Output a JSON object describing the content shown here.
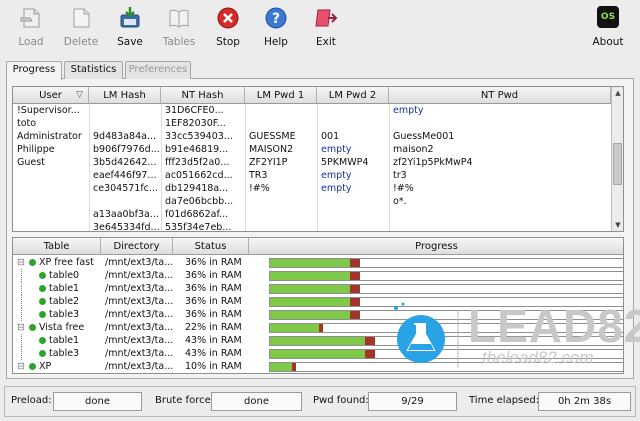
{
  "toolbar": {
    "load": "Load",
    "delete": "Delete",
    "save": "Save",
    "tables": "Tables",
    "stop": "Stop",
    "help": "Help",
    "exit": "Exit",
    "about": "About",
    "about_badge": "OS"
  },
  "tabs": [
    "Progress",
    "Statistics",
    "Preferences"
  ],
  "upper_table": {
    "columns": [
      "User",
      "LM Hash",
      "NT Hash",
      "LM Pwd 1",
      "LM Pwd 2",
      "NT Pwd"
    ],
    "rows": [
      [
        "!Supervisor...",
        "",
        "31D6CFE0...",
        "",
        "",
        "empty"
      ],
      [
        "toto",
        "",
        "1EF82030F...",
        "",
        "",
        ""
      ],
      [
        "Administrator",
        "9d483a84a...",
        "33cc539403...",
        "GUESSME",
        "001",
        "GuessMe001"
      ],
      [
        "Philippe",
        "b906f7976d...",
        "b91e46819...",
        "MAISON2",
        "empty",
        "maison2"
      ],
      [
        "Guest",
        "3b5d42642...",
        "fff23d5f2a0...",
        "ZF2YI1P",
        "5PKMWP4",
        "zf2Yi1p5PkMwP4"
      ],
      [
        "",
        "eaef446f97...",
        "ac051662cd...",
        "TR3",
        "empty",
        "tr3"
      ],
      [
        "",
        "ce304571fc...",
        "db129418a...",
        "!#%",
        "empty",
        "!#%"
      ],
      [
        "",
        "",
        "da7e06bcbb...",
        "",
        "",
        "o*."
      ],
      [
        "",
        "a13aa0bf3a...",
        "f01d6862af...",
        "",
        "",
        ""
      ],
      [
        "",
        "3e645334fd...",
        "535f34e7eb...",
        "",
        "",
        ""
      ]
    ],
    "blue_values": [
      "empty"
    ]
  },
  "lower_table": {
    "columns": [
      "Table",
      "Directory",
      "Status",
      "Progress"
    ],
    "rows": [
      {
        "indent": 0,
        "name": "XP free fast",
        "dir": "/mnt/ext3/ta...",
        "status": "36% in RAM",
        "progress": 0.36
      },
      {
        "indent": 1,
        "name": "table0",
        "dir": "/mnt/ext3/ta...",
        "status": "36% in RAM",
        "progress": 0.36
      },
      {
        "indent": 1,
        "name": "table1",
        "dir": "/mnt/ext3/ta...",
        "status": "36% in RAM",
        "progress": 0.36
      },
      {
        "indent": 1,
        "name": "table2",
        "dir": "/mnt/ext3/ta...",
        "status": "36% in RAM",
        "progress": 0.36
      },
      {
        "indent": 1,
        "name": "table3",
        "dir": "/mnt/ext3/ta...",
        "status": "36% in RAM",
        "progress": 0.36
      },
      {
        "indent": 0,
        "name": "Vista free",
        "dir": "/mnt/ext3/ta...",
        "status": "22% in RAM",
        "progress": 0.22
      },
      {
        "indent": 1,
        "name": "table1",
        "dir": "/mnt/ext3/ta...",
        "status": "43% in RAM",
        "progress": 0.43
      },
      {
        "indent": 1,
        "name": "table3",
        "dir": "/mnt/ext3/ta...",
        "status": "43% in RAM",
        "progress": 0.43
      },
      {
        "indent": 0,
        "name": "XP",
        "dir": "/mnt/ext3/ta...",
        "status": "10% in RAM",
        "progress": 0.1
      }
    ]
  },
  "status_bar": {
    "preload_label": "Preload:",
    "preload_value": "done",
    "brute_label": "Brute force:",
    "brute_value": "done",
    "pwd_label": "Pwd found:",
    "pwd_value": "9/29",
    "time_label": "Time elapsed:",
    "time_value": "0h 2m 38s"
  },
  "watermark": {
    "brand": "LEAD82",
    "url": "thelead82.com"
  },
  "colors": {
    "progress_green": "#7ec948",
    "progress_red": "#a4332a",
    "blue_text": "#1a2fb0",
    "logo_blue": "#2aa3e6"
  }
}
